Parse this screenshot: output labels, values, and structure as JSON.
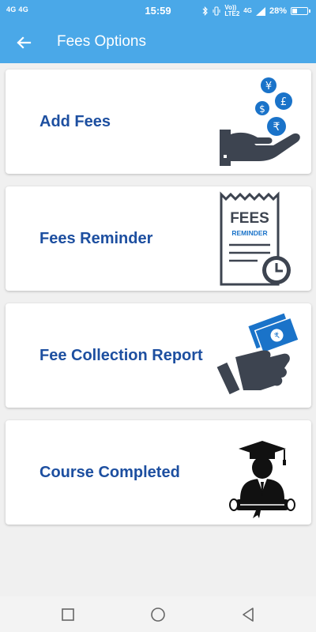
{
  "status_bar": {
    "signal_left": "4G 4G",
    "time": "15:59",
    "network_small_1": "Vo))",
    "network_small_2": "LTE2",
    "network_4g": "4G",
    "battery": "28%"
  },
  "app_bar": {
    "title": "Fees Options",
    "back_icon": "arrow-left-icon"
  },
  "cards": [
    {
      "label": "Add Fees",
      "icon": "money-hand-icon"
    },
    {
      "label": "Fees Reminder",
      "icon": "fees-receipt-clock-icon",
      "icon_text_1": "FEES",
      "icon_text_2": "REMINDER"
    },
    {
      "label": "Fee Collection Report",
      "icon": "cash-hand-icon"
    },
    {
      "label": "Course Completed",
      "icon": "graduate-icon"
    }
  ],
  "colors": {
    "primary": "#4aa8e8",
    "card_text": "#1d4fa0",
    "icon_dark": "#3d4450",
    "icon_blue": "#1a73c9"
  },
  "nav_bar": {
    "items": [
      "square-icon",
      "circle-icon",
      "triangle-back-icon"
    ]
  }
}
